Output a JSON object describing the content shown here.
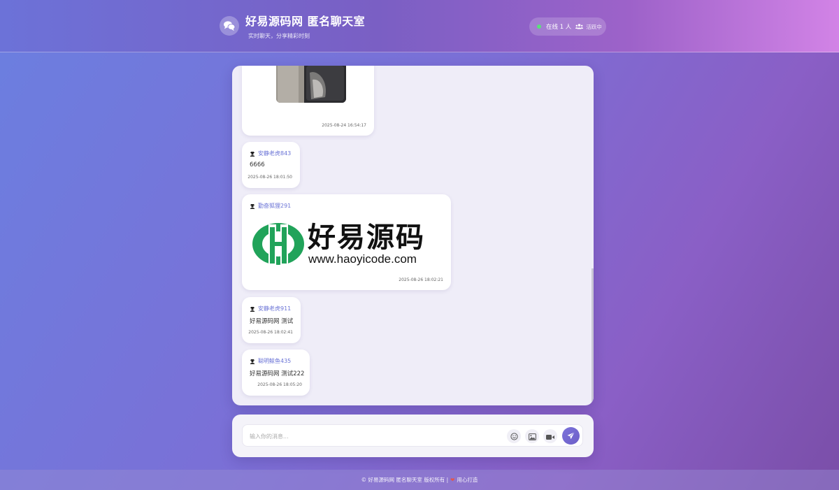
{
  "header": {
    "title": "好易源码网 匿名聊天室",
    "subtitle": "实时聊天，分享精彩时刻",
    "online_text": "在线 1 人",
    "active_text": "活跃中",
    "online_dot_color": "#5be07a"
  },
  "messages": [
    {
      "type": "image",
      "user": "",
      "image": "phone-photo",
      "time": "2025-08-24 16:54:17"
    },
    {
      "type": "text",
      "user": "安静老虎843",
      "text": "6666",
      "time": "2025-08-26 18:01:50"
    },
    {
      "type": "image",
      "user": "勤奋狐狸291",
      "image": "haoyicode-logo",
      "logo_text": "好易源码",
      "logo_url": "www.haoyicode.com",
      "time": "2025-08-26 18:02:21"
    },
    {
      "type": "text",
      "user": "安静老虎911",
      "text": "好易源码网 测试",
      "time": "2025-08-26 18:02:41"
    },
    {
      "type": "text",
      "user": "聪明鲸鱼435",
      "text": "好易源码网 测试222",
      "time": "2025-08-26 18:05:20"
    }
  ],
  "input": {
    "placeholder": "输入你的消息...",
    "value": ""
  },
  "toolbar": {
    "icons": [
      "emoji-icon",
      "image-icon",
      "video-icon",
      "send-icon"
    ]
  },
  "footer": {
    "left": "© 好易源码网 匿名聊天室 版权所有 |",
    "right": "用心打造"
  },
  "colors": {
    "accent": "#6a73d6",
    "send_button": "#7b72da",
    "heart": "#e2574c"
  }
}
